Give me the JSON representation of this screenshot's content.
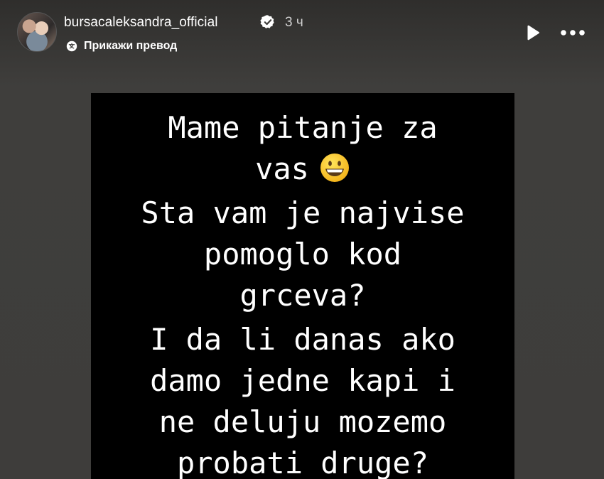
{
  "header": {
    "username": "bursacaleksandra_official",
    "timestamp": "3 ч",
    "translate_label": "Прикажи превод"
  },
  "icons": {
    "avatar": "profile-avatar",
    "verified": "verified-badge-icon",
    "translate": "translate-icon",
    "play": "play-icon",
    "more": "more-dots-icon",
    "emoji": "grinning-face-emoji"
  },
  "story": {
    "lines": [
      "Mame pitanje za",
      "vas",
      "Sta vam je najvise",
      "pomoglo kod",
      "grceva?",
      "I da li danas ako",
      "damo jedne kapi i",
      "ne deluju mozemo",
      "probati druge?"
    ]
  },
  "colors": {
    "background": "#3e3d3b",
    "text_block": "#000000",
    "text": "#ffffff"
  }
}
